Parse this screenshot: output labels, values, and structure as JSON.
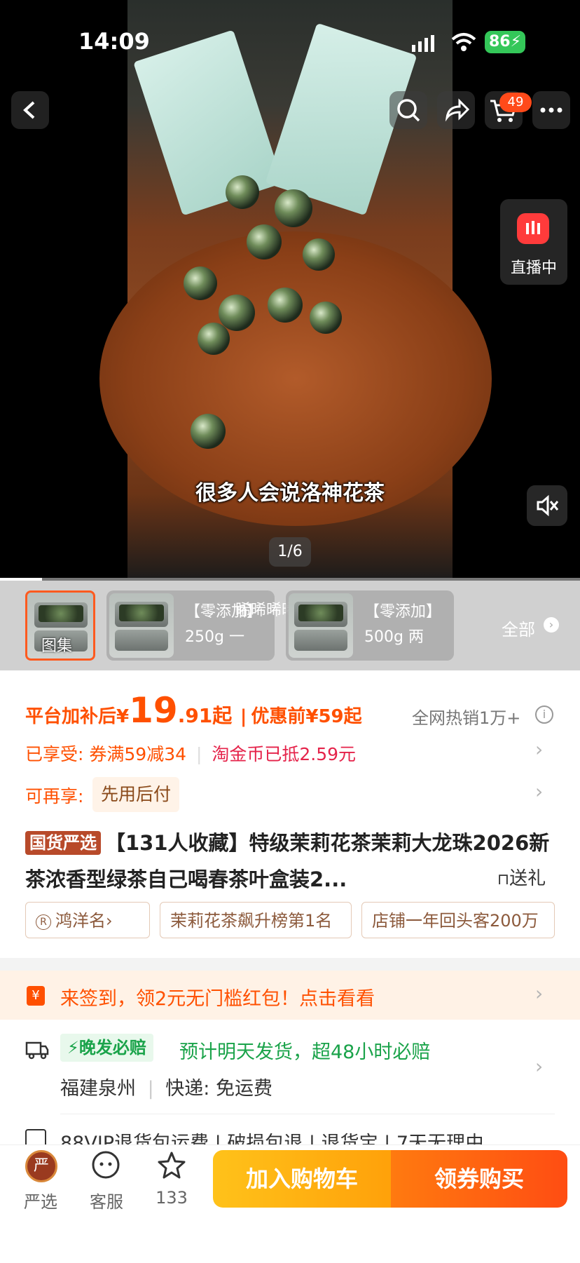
{
  "status_bar": {
    "time": "14:09",
    "battery": "86"
  },
  "header": {
    "cart_count": "49"
  },
  "live": {
    "label": "直播中"
  },
  "video": {
    "subtitle": "很多人会说洛神花茶",
    "page_indicator": "1/6"
  },
  "sku": {
    "gallery_label": "图集",
    "overlay_text": "睎晞晞晞",
    "items": [
      {
        "line1": "【零添加】",
        "line2": "250g 一"
      },
      {
        "line1": "【零添加】",
        "line2": "500g 两"
      }
    ],
    "all_label": "全部"
  },
  "price": {
    "prefix": "平台加补后¥",
    "integer": "19",
    "decimal": ".91起",
    "original": "优惠前¥59起",
    "sales": "全网热销1万+"
  },
  "promo": {
    "enjoyed_label": "已享受:",
    "coupon": "券满59减34",
    "coin": "淘金币已抵2.59元",
    "more_label": "可再享:",
    "pay_later": "先用后付"
  },
  "product": {
    "brand_badge": "国货严选",
    "title": "【131人收藏】特级茉莉花茶茉莉大龙珠2026新茶浓香型绿茶自己喝春茶叶盒装2...",
    "gift_label": "送礼"
  },
  "chips": [
    "鸿洋名›",
    "茉莉花茶飙升榜第1名",
    "店铺一年回头客200万"
  ],
  "signin_banner": "来签到，领2元无门槛红包！点击看看",
  "delivery": {
    "badge": "晚发必赔",
    "promise": "预计明天发货，超48小时必赔",
    "origin": "福建泉州",
    "express": "快递: 免运费"
  },
  "service_row": "88VIP退货包运费 | 破损包退 | 退货宝 | 7天无理由",
  "bottom_bar": {
    "shop_label": "严选",
    "service_label": "客服",
    "fav_count": "133",
    "add_cart": "加入购物车",
    "buy": "领券购买"
  }
}
